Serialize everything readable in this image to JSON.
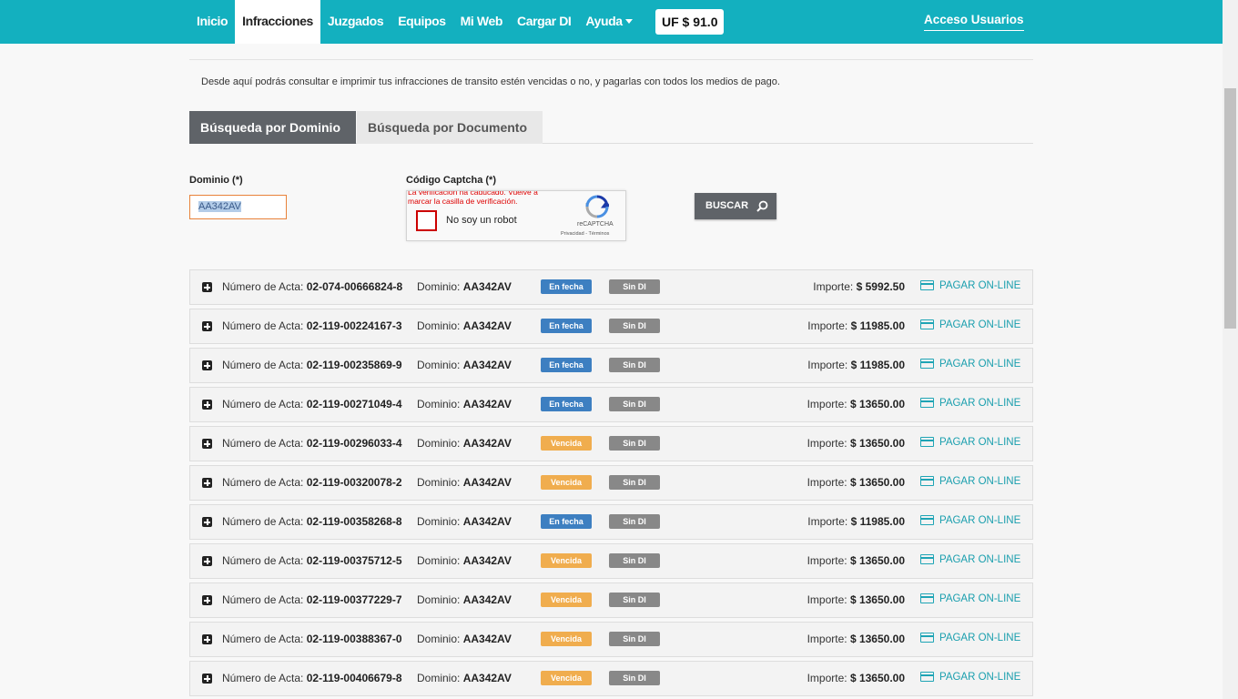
{
  "nav": {
    "items": [
      "Inicio",
      "Infracciones",
      "Juzgados",
      "Equipos",
      "Mi Web",
      "Cargar DI",
      "Ayuda"
    ],
    "active": "Infracciones",
    "uf": "UF $ 91.0",
    "acceso": "Acceso Usuarios"
  },
  "intro": "Desde aquí podrás consultar e imprimir tus infracciones de transito estén vencidas o no, y pagarlas con todos los medios de pago.",
  "tabs": [
    "Búsqueda por Dominio",
    "Búsqueda por Documento"
  ],
  "form": {
    "dominio_label": "Dominio (*)",
    "dominio_value": "AA342AV",
    "captcha_label": "Código Captcha (*)",
    "captcha_error": "La verificación ha caducado. Vuelve a marcar la casilla de verificación.",
    "captcha_text": "No soy un robot",
    "recaptcha_brand": "reCAPTCHA",
    "recaptcha_links": "Privacidad - Términos",
    "buscar": "BUSCAR"
  },
  "colors": {
    "navbar": "#13b0bf",
    "en_fecha": "#3d7fc1",
    "vencida": "#f0ad4e",
    "sin_dl": "#888888",
    "pagar": "#1a9fae"
  },
  "row_labels": {
    "acta": "Número de Acta:",
    "dominio": "Dominio:",
    "importe": "Importe:",
    "pagar": "PAGAR ON-LINE"
  },
  "actas": [
    {
      "numero": "02-074-00666824-8",
      "dominio": "AA342AV",
      "estado": "En fecha",
      "dl": "Sin DI",
      "importe": "$ 5992.50"
    },
    {
      "numero": "02-119-00224167-3",
      "dominio": "AA342AV",
      "estado": "En fecha",
      "dl": "Sin DI",
      "importe": "$ 11985.00"
    },
    {
      "numero": "02-119-00235869-9",
      "dominio": "AA342AV",
      "estado": "En fecha",
      "dl": "Sin DI",
      "importe": "$ 11985.00"
    },
    {
      "numero": "02-119-00271049-4",
      "dominio": "AA342AV",
      "estado": "En fecha",
      "dl": "Sin DI",
      "importe": "$ 13650.00"
    },
    {
      "numero": "02-119-00296033-4",
      "dominio": "AA342AV",
      "estado": "Vencida",
      "dl": "Sin DI",
      "importe": "$ 13650.00"
    },
    {
      "numero": "02-119-00320078-2",
      "dominio": "AA342AV",
      "estado": "Vencida",
      "dl": "Sin DI",
      "importe": "$ 13650.00"
    },
    {
      "numero": "02-119-00358268-8",
      "dominio": "AA342AV",
      "estado": "En fecha",
      "dl": "Sin DI",
      "importe": "$ 11985.00"
    },
    {
      "numero": "02-119-00375712-5",
      "dominio": "AA342AV",
      "estado": "Vencida",
      "dl": "Sin DI",
      "importe": "$ 13650.00"
    },
    {
      "numero": "02-119-00377229-7",
      "dominio": "AA342AV",
      "estado": "Vencida",
      "dl": "Sin DI",
      "importe": "$ 13650.00"
    },
    {
      "numero": "02-119-00388367-0",
      "dominio": "AA342AV",
      "estado": "Vencida",
      "dl": "Sin DI",
      "importe": "$ 13650.00"
    },
    {
      "numero": "02-119-00406679-8",
      "dominio": "AA342AV",
      "estado": "Vencida",
      "dl": "Sin DI",
      "importe": "$ 13650.00"
    }
  ]
}
